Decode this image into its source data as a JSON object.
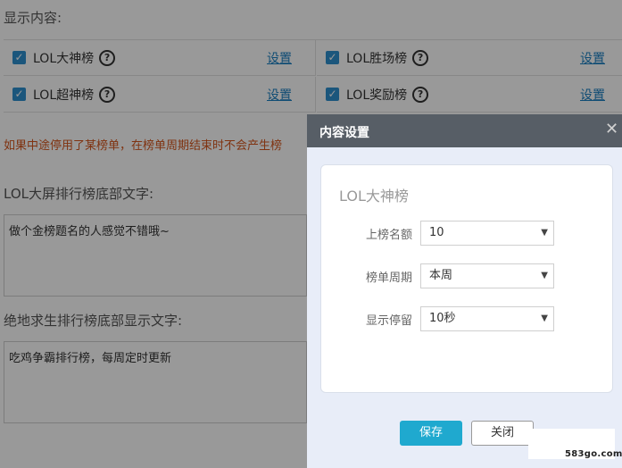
{
  "display": {
    "title": "显示内容:",
    "items": [
      {
        "label": "LOL大神榜",
        "link": "设置"
      },
      {
        "label": "LOL胜场榜",
        "link": "设置"
      },
      {
        "label": "LOL超神榜",
        "link": "设置"
      },
      {
        "label": "LOL奖励榜",
        "link": "设置"
      }
    ],
    "help_glyph": "?",
    "check_glyph": "✓"
  },
  "warning": "如果中途停用了某榜单，在榜单周期结束时不会产生榜",
  "lol_footer": {
    "label": "LOL大屏排行榜底部文字:",
    "value": "做个金榜题名的人感觉不错哦~"
  },
  "pubg_footer": {
    "label": "绝地求生排行榜底部显示文字:",
    "value": "吃鸡争霸排行榜，每周定时更新"
  },
  "modal": {
    "title": "内容设置",
    "close_glyph": "✕",
    "card_title": "LOL大神榜",
    "fields": [
      {
        "label": "上榜名额",
        "value": "10"
      },
      {
        "label": "榜单周期",
        "value": "本周"
      },
      {
        "label": "显示停留",
        "value": "10秒"
      }
    ],
    "caret_glyph": "▼",
    "save_label": "保存",
    "close_label": "关闭"
  },
  "watermark": "583go.com",
  "colors": {
    "accent": "#1fa9cf",
    "link": "#1a7fc1",
    "warning": "#d5561d",
    "checkbox": "#2e8fcf",
    "header": "#575e66"
  }
}
